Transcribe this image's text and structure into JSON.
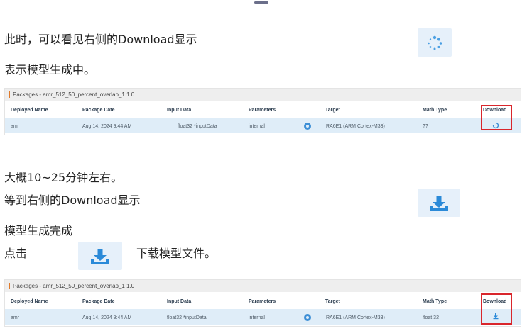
{
  "texts": {
    "line1": "此时，可以看见右侧的Download显示",
    "line2": "表示模型生成中。",
    "line3": "大概10~25分钟左右。",
    "line4": "等到右侧的Download显示",
    "line5": "模型生成完成",
    "line6a": "点击",
    "line6b": "下载模型文件。"
  },
  "icons": {
    "loading": "spinner-icon",
    "download": "download-tray-icon"
  },
  "table1": {
    "title": "Packages - amr_512_50_percent_overlap_1 1.0",
    "headers": [
      "Deployed Name",
      "Package Date",
      "Input Data",
      "Parameters",
      "Target",
      "Math Type",
      "Download"
    ],
    "row": {
      "name": "amr",
      "date": "Aug 14, 2024 9:44 AM",
      "input": "float32 *inputData",
      "params": "internal",
      "target": "RA6E1 (ARM Cortex-M33)",
      "math": "??"
    }
  },
  "table2": {
    "title": "Packages - amr_512_50_percent_overlap_1 1.0",
    "headers": [
      "Deployed Name",
      "Package Date",
      "Input Data",
      "Parameters",
      "Target",
      "Math Type",
      "Download"
    ],
    "row": {
      "name": "amr",
      "date": "Aug 14, 2024 9:44 AM",
      "input": "float32 *inputData",
      "params": "internal",
      "target": "RA6E1 (ARM Cortex-M33)",
      "math": "float 32"
    }
  },
  "colors": {
    "accent": "#3d8fd6",
    "highlight": "#d9262c",
    "row_bg": "#dfedf8",
    "header_bar": "#e07a2a",
    "icon_bg": "#e6f0fa"
  }
}
